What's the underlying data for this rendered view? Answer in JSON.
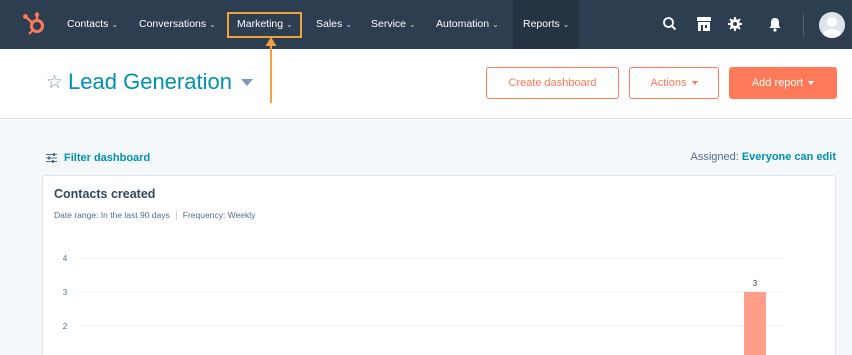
{
  "nav": {
    "items": [
      {
        "label": "Contacts"
      },
      {
        "label": "Conversations"
      },
      {
        "label": "Marketing"
      },
      {
        "label": "Sales"
      },
      {
        "label": "Service"
      },
      {
        "label": "Automation"
      },
      {
        "label": "Reports"
      }
    ],
    "chevron": "⌄",
    "icons": [
      "search-icon",
      "marketplace-icon",
      "gear-icon",
      "bell-icon"
    ],
    "avatar": "user-avatar-icon",
    "highlighted_item": "Marketing",
    "active_item": "Reports"
  },
  "header": {
    "title": "Lead Generation",
    "favorite_icon": "star-icon",
    "create_dashboard_label": "Create dashboard",
    "actions_label": "Actions",
    "add_report_label": "Add report"
  },
  "toolbar": {
    "filter_label": "Filter dashboard",
    "assigned_label": "Assigned:",
    "assigned_value": "Everyone can edit"
  },
  "card": {
    "title": "Contacts created",
    "date_range": "Date range: In the last 90 days",
    "frequency": "Frequency: Weekly"
  },
  "chart_data": {
    "type": "bar",
    "title": "Contacts created",
    "y_ticks": [
      4,
      3,
      2
    ],
    "series": [
      {
        "values": [
          3
        ],
        "data_labels": [
          "3"
        ]
      }
    ],
    "grid": true
  },
  "colors": {
    "nav_bg": "#2d3e50",
    "accent": "#ff7a59",
    "link": "#0091ae",
    "highlight": "#f0a23c",
    "bar": "#ff9f8a"
  }
}
